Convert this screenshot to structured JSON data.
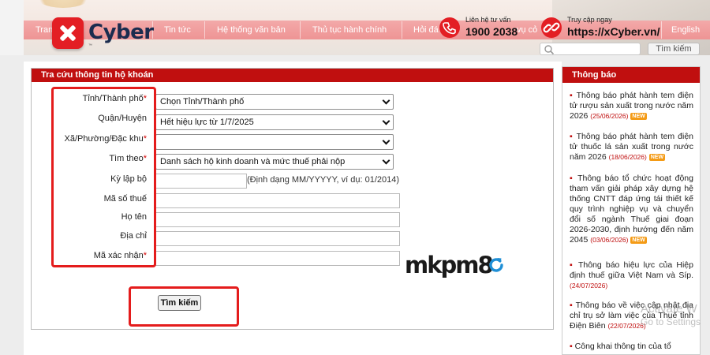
{
  "banner": {
    "menu": [
      "Tran",
      "Tin tức",
      "Hệ thống văn bản",
      "Thủ tục hành chính",
      "Hỏi đá",
      "vụ cỏ",
      "English"
    ],
    "search_button": "Tìm kiếm"
  },
  "overlay": {
    "logo_text": "Cyber",
    "logo_tm": "™",
    "hotline_label": "Liên hệ tư vấn",
    "hotline_number": "1900 2038",
    "web_label": "Truy cập ngay",
    "web_url": "https://xCyber.vn/"
  },
  "form": {
    "title": "Tra cứu thông tin hộ khoán",
    "fields": [
      {
        "label": "Tỉnh/Thành phố",
        "required": true,
        "value": "Chọn Tỉnh/Thành phố"
      },
      {
        "label": "Quận/Huyện",
        "required": false,
        "value": "Hết hiệu lực từ 1/7/2025"
      },
      {
        "label": "Xã/Phường/Đặc khu",
        "required": true,
        "value": ""
      },
      {
        "label": "Tìm theo",
        "required": true,
        "value": "Danh sách hộ kinh doanh và mức thuế phải nộp"
      },
      {
        "label": "Kỳ lập bộ",
        "required": false,
        "value": ""
      },
      {
        "label": "Mã số thuế",
        "required": false,
        "value": ""
      },
      {
        "label": "Họ tên",
        "required": false,
        "value": ""
      },
      {
        "label": "Địa chỉ",
        "required": false,
        "value": ""
      },
      {
        "label": "Mã xác nhận",
        "required": true,
        "value": ""
      }
    ],
    "period_hint": "(Định dạng MM/YYYYY, ví dụ: 01/2014)",
    "captcha_text": "mkpm8",
    "submit_label": "Tìm kiếm",
    "required_mark": "*"
  },
  "sidebar": {
    "title": "Thông báo",
    "news": [
      {
        "text": "Thông báo phát hành tem điện tử rượu sản xuất trong nước năm 2026",
        "date": "(25/06/2026)",
        "is_new": true
      },
      {
        "text": "Thông báo phát hành tem điện tử thuốc lá sản xuất trong nước năm 2026",
        "date": "(18/06/2026)",
        "is_new": true
      },
      {
        "text": "Thông báo tổ chức hoạt động tham vấn giải pháp xây dựng hệ thống CNTT đáp ứng tái thiết kế quy trình nghiệp vụ và chuyển đổi số ngành Thuế giai đoạn 2026-2030, định hướng đến năm 2045",
        "date": "(03/06/2026)",
        "is_new": true
      },
      {
        "text": "Thông báo hiệu lực của Hiệp định thuế giữa Việt Nam và Síp.",
        "date": "(24/07/2026)",
        "is_new": false
      },
      {
        "text": "Thông báo về việc cập nhật địa chỉ trụ sở làm việc của Thuế tỉnh Điện Biên",
        "date": "(22/07/2026)",
        "is_new": false
      },
      {
        "text": "Công khai thông tin của tổ",
        "date": "",
        "is_new": false
      }
    ],
    "new_badge": "NEW"
  },
  "os": {
    "watermark_line1": "Activate W",
    "watermark_line2": "Go to Settings"
  },
  "colors": {
    "header_red": "#c00f0f",
    "highlight_red": "#e41c1c",
    "brand_red": "#e31e24",
    "refresh_blue": "#1f8fd6"
  }
}
